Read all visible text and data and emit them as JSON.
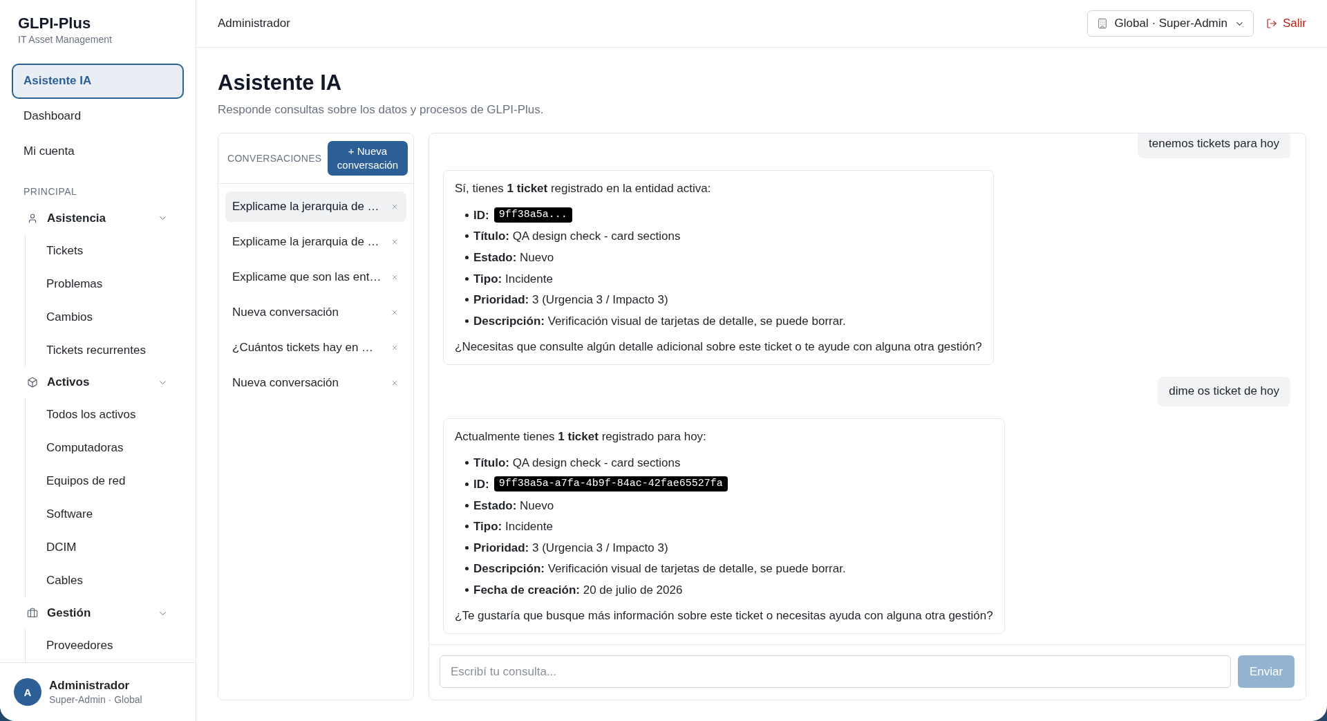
{
  "sidebar": {
    "brand": {
      "title": "GLPI-Plus",
      "subtitle": "IT Asset Management"
    },
    "top_items": [
      {
        "label": "Asistente IA",
        "selected": true
      },
      {
        "label": "Dashboard",
        "selected": false
      },
      {
        "label": "Mi cuenta",
        "selected": false
      }
    ],
    "sections": [
      {
        "title": "PRINCIPAL",
        "groups": [
          {
            "label": "Asistencia",
            "expanded": true,
            "children": [
              {
                "label": "Tickets",
                "selected": false
              },
              {
                "label": "Problemas",
                "selected": false
              },
              {
                "label": "Cambios",
                "selected": false
              },
              {
                "label": "Tickets recurrentes",
                "selected": false
              }
            ]
          },
          {
            "label": "Activos",
            "expanded": true,
            "children": [
              {
                "label": "Todos los activos",
                "selected": false
              },
              {
                "label": "Computadoras",
                "selected": false
              },
              {
                "label": "Equipos de red",
                "selected": false
              },
              {
                "label": "Software",
                "selected": false
              },
              {
                "label": "DCIM",
                "selected": false
              },
              {
                "label": "Cables",
                "selected": false
              }
            ]
          },
          {
            "label": "Gestión",
            "expanded": true,
            "children": [
              {
                "label": "Proveedores",
                "selected": false
              }
            ]
          }
        ]
      }
    ],
    "user": {
      "initial": "A",
      "name": "Administrador",
      "role": "Super-Admin · Global"
    }
  },
  "header": {
    "title": "Administrador",
    "scope": "Global · Super-Admin",
    "logout": "Salir"
  },
  "page": {
    "title": "Asistente IA",
    "subtitle": "Responde consultas sobre los datos y procesos de GLPI-Plus."
  },
  "conversations": {
    "heading": "CONVERSACIONES",
    "new_button": "+ Nueva conversación",
    "items": [
      {
        "title": "Explicame la jerarquia de …",
        "selected": true
      },
      {
        "title": "Explicame la jerarquia de …",
        "selected": false
      },
      {
        "title": "Explicame que son las ent…",
        "selected": false
      },
      {
        "title": "Nueva conversación",
        "selected": false
      },
      {
        "title": "¿Cuántos tickets hay en …",
        "selected": false
      },
      {
        "title": "Nueva conversación",
        "selected": false
      }
    ]
  },
  "chat": {
    "messages": [
      {
        "kind": "user",
        "text": "tenemos tickets para hoy"
      },
      {
        "kind": "assistant",
        "intro": "Sí, tienes **1 ticket** registrado en la entidad activa:",
        "items": [
          {
            "kind": "code",
            "label": "ID:",
            "value": "9ff38a5a..."
          },
          {
            "kind": "text",
            "text": "**Título:** QA design check - card sections"
          },
          {
            "kind": "text",
            "text": "**Estado:** Nuevo"
          },
          {
            "kind": "text",
            "text": "**Tipo:** Incidente"
          },
          {
            "kind": "text",
            "text": "**Prioridad:** 3 (Urgencia 3 / Impacto 3)"
          },
          {
            "kind": "text",
            "text": "**Descripción:** Verificación visual de tarjetas de detalle, se puede borrar."
          }
        ],
        "outro": "¿Necesitas que consulte algún detalle adicional sobre este ticket o te ayude con alguna otra gestión?"
      },
      {
        "kind": "user",
        "text": "dime os ticket de hoy"
      },
      {
        "kind": "assistant",
        "intro": "Actualmente tienes **1 ticket** registrado para hoy:",
        "items": [
          {
            "kind": "text",
            "text": "**Título:** QA design check - card sections"
          },
          {
            "kind": "code",
            "label": "ID:",
            "value": "9ff38a5a-a7fa-4b9f-84ac-42fae65527fa"
          },
          {
            "kind": "text",
            "text": "**Estado:** Nuevo"
          },
          {
            "kind": "text",
            "text": "**Tipo:** Incidente"
          },
          {
            "kind": "text",
            "text": "**Prioridad:** 3 (Urgencia 3 / Impacto 3)"
          },
          {
            "kind": "text",
            "text": "**Descripción:** Verificación visual de tarjetas de detalle, se puede borrar."
          },
          {
            "kind": "text",
            "text": "**Fecha de creación:** 20 de julio de 2026"
          }
        ],
        "outro": "¿Te gustaría que busque más información sobre este ticket o necesitas ayuda con alguna otra gestión?"
      }
    ],
    "composer": {
      "placeholder": "Escribí tu consulta...",
      "send": "Enviar",
      "send_disabled": true
    }
  }
}
